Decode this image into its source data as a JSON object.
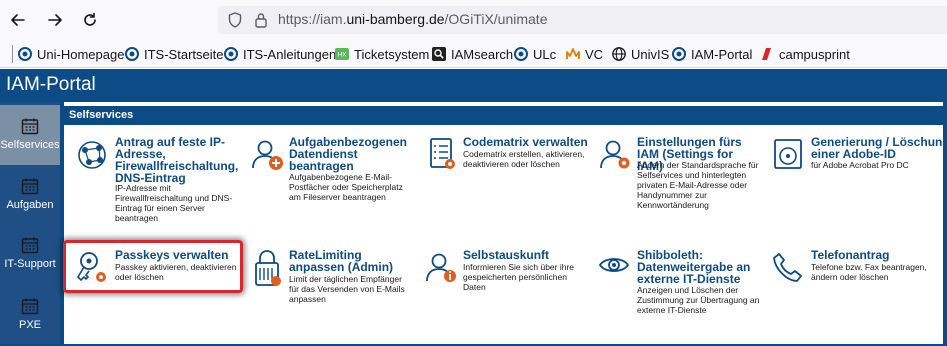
{
  "browser": {
    "url_prefix": "https://iam.",
    "url_domain": "uni-bamberg.de",
    "url_path": "/OGiTiX/unimate",
    "bookmarks": [
      {
        "label": "Uni-Homepage",
        "icon": "uni-logo-icon"
      },
      {
        "label": "ITS-Startseite",
        "icon": "uni-logo-icon"
      },
      {
        "label": "ITS-Anleitungen",
        "icon": "uni-logo-icon"
      },
      {
        "label": "Ticketsystem",
        "icon": "ticket-icon"
      },
      {
        "label": "IAMsearch",
        "icon": "search-icon"
      },
      {
        "label": "ULc",
        "icon": "uni-logo-icon"
      },
      {
        "label": "VC",
        "icon": "vc-icon"
      },
      {
        "label": "UnivIS",
        "icon": "globe-icon"
      },
      {
        "label": "IAM-Portal",
        "icon": "uni-logo-icon"
      },
      {
        "label": "campusprint",
        "icon": "campusprint-icon"
      }
    ]
  },
  "app": {
    "title": "IAM-Portal",
    "accent": "#0d4b86"
  },
  "rail": [
    {
      "label": "Selfservices",
      "icon": "calendar-icon",
      "active": true
    },
    {
      "label": "Aufgaben",
      "icon": "calendar-icon",
      "active": false
    },
    {
      "label": "IT-Support",
      "icon": "calendar-icon",
      "active": false
    },
    {
      "label": "PXE",
      "icon": "calendar-icon",
      "active": false
    }
  ],
  "section": {
    "title": "Selfservices"
  },
  "tiles": [
    {
      "title": "Antrag auf feste IP-Adresse, Firewallfreischaltung, DNS-Eintrag",
      "desc": "IP-Adresse mit Firewallfreischaltung und DNS-Eintrag für einen Server beantragen",
      "icon": "network-icon"
    },
    {
      "title": "Aufgabenbezogenen Datendienst beantragen",
      "desc": "Aufgabenbezogene E-Mail-Postfächer oder Speicherplatz am Fileserver beantragen",
      "icon": "user-add-icon"
    },
    {
      "title": "Codematrix verwalten",
      "desc": "Codematrix erstellen, aktivieren, deaktivieren oder löschen",
      "icon": "checklist-icon"
    },
    {
      "title": "Einstellungen fürs IAM (Settings for IAM)",
      "desc": "Ändern der Standardsprache für Selfservices und hinterlegten privaten E-Mail-Adresse oder Handynummer zur Kennwortänderung",
      "icon": "user-settings-icon"
    },
    {
      "title": "Generierung / Löschung einer Adobe-ID",
      "desc": "für Adobe Acrobat Pro DC",
      "icon": "disc-icon"
    },
    {
      "title": "Passkeys verwalten",
      "desc": "Passkey aktivieren, deaktivieren oder löschen",
      "icon": "key-icon"
    },
    {
      "title": "RateLimiting anpassen (Admin)",
      "desc": "Limit der täglichen Empfänger für das Versenden von E-Mails anpassen",
      "icon": "lock-icon"
    },
    {
      "title": "Selbstauskunft",
      "desc": "Informieren Sie sich über ihre gespeicherten persönlichen Daten",
      "icon": "user-info-icon"
    },
    {
      "title": "Shibboleth: Datenweitergabe an externe IT-Dienste",
      "desc": "Anzeigen und Löschen der Zustimmung zur Übertragung an externe IT-Dienste",
      "icon": "eye-icon"
    },
    {
      "title": "Telefonantrag",
      "desc": "Telefone bzw. Fax beantragen, ändern oder löschen",
      "icon": "phone-icon"
    }
  ]
}
